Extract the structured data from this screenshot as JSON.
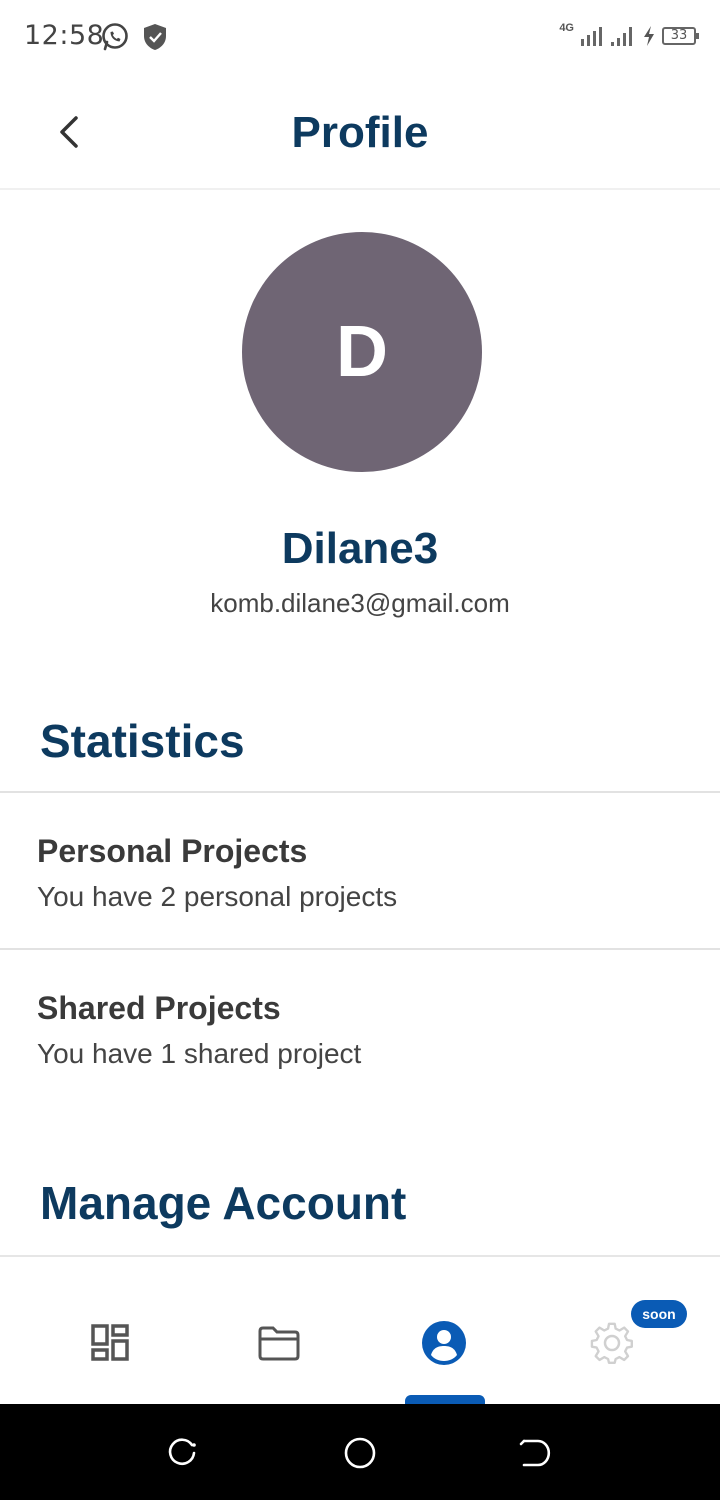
{
  "status_bar": {
    "time": "12:58",
    "network_label": "4G",
    "battery_level": "33",
    "icons": [
      "whatsapp-icon",
      "shield-icon",
      "signal-4g-icon",
      "signal-icon",
      "charging-icon",
      "battery-icon"
    ]
  },
  "header": {
    "title": "Profile",
    "back_icon": "chevron-left-icon"
  },
  "profile": {
    "avatar_initial": "D",
    "avatar_color": "#6f6574",
    "name": "Dilane3",
    "email": "komb.dilane3@gmail.com"
  },
  "statistics": {
    "title": "Statistics",
    "items": [
      {
        "label": "Personal Projects",
        "description": "You have 2 personal projects"
      },
      {
        "label": "Shared Projects",
        "description": "You have 1 shared project"
      }
    ]
  },
  "manage_account": {
    "title": "Manage Account"
  },
  "bottom_nav": {
    "items": [
      {
        "name": "dashboard",
        "icon": "dashboard-icon",
        "active": false
      },
      {
        "name": "projects",
        "icon": "folder-icon",
        "active": false
      },
      {
        "name": "profile",
        "icon": "user-circle-icon",
        "active": true
      },
      {
        "name": "settings",
        "icon": "gear-icon",
        "active": false,
        "badge": "soon"
      }
    ],
    "badge_label": "soon"
  },
  "colors": {
    "primary": "#0d3a5f",
    "accent": "#0a5bb5",
    "inactive_icon": "#555555",
    "disabled_icon": "#d0d0d0"
  }
}
